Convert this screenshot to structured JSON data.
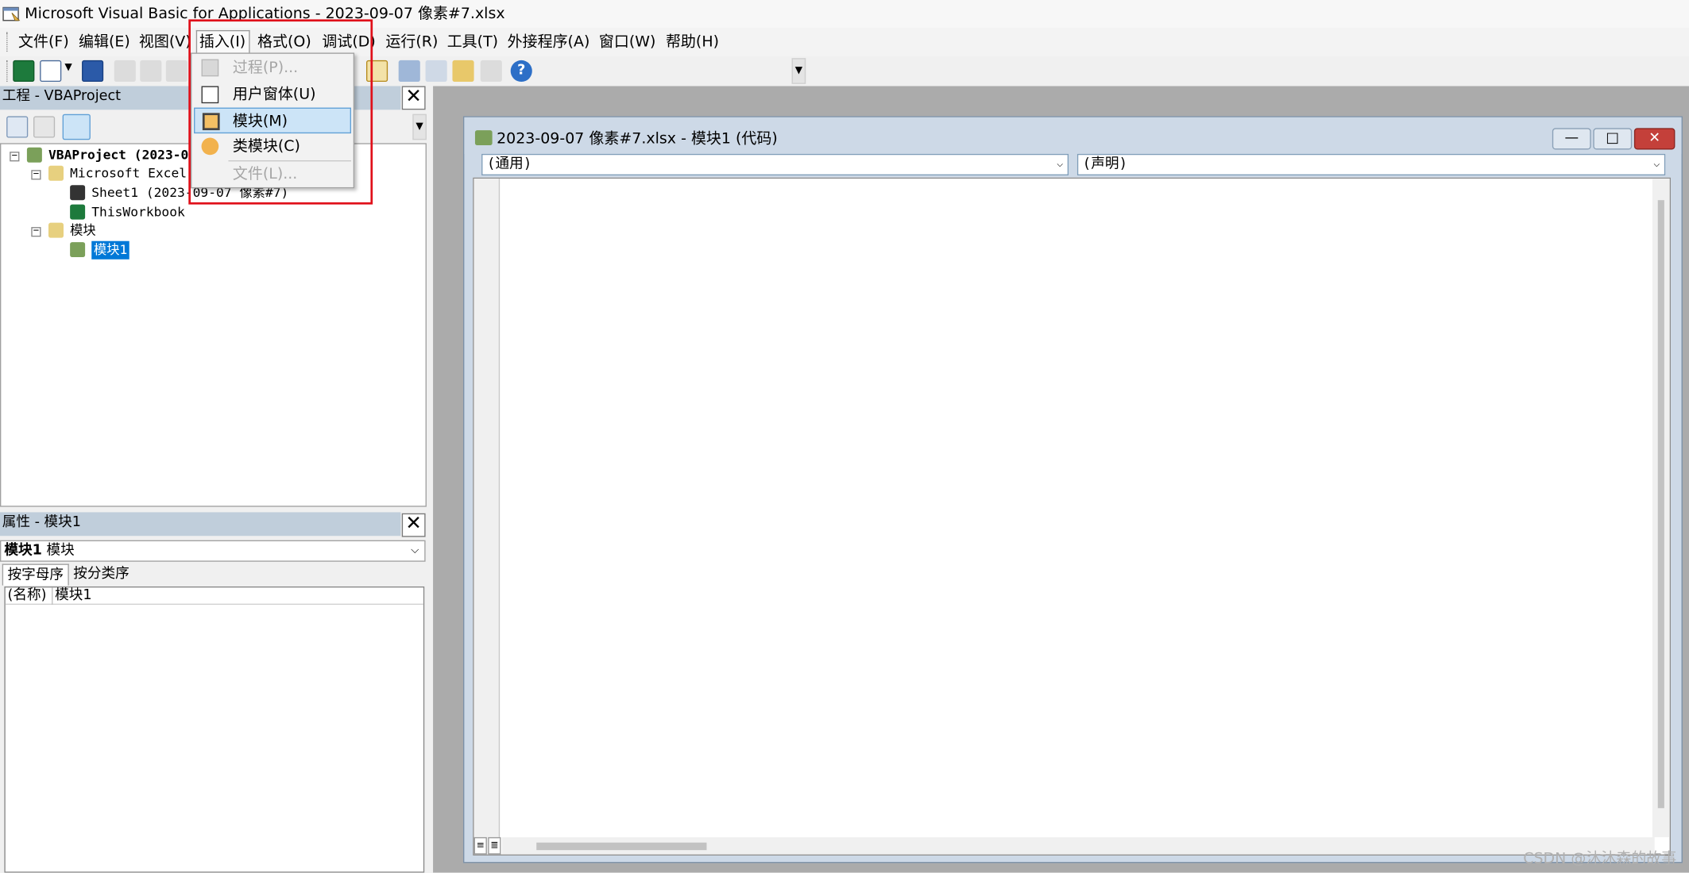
{
  "window": {
    "title": "Microsoft Visual Basic for Applications - 2023-09-07 像素#7.xlsx"
  },
  "menubar": {
    "items": [
      "文件(F)",
      "编辑(E)",
      "视图(V)",
      "插入(I)",
      "格式(O)",
      "调试(D)",
      "运行(R)",
      "工具(T)",
      "外接程序(A)",
      "窗口(W)",
      "帮助(H)"
    ],
    "active": "插入(I)"
  },
  "insert_menu": {
    "items": [
      {
        "label": "过程(P)...",
        "enabled": false,
        "icon": "procedure-icon"
      },
      {
        "label": "用户窗体(U)",
        "enabled": true,
        "icon": "userform-icon"
      },
      {
        "label": "模块(M)",
        "enabled": true,
        "highlighted": true,
        "icon": "module-icon"
      },
      {
        "label": "类模块(C)",
        "enabled": true,
        "icon": "class-module-icon"
      },
      {
        "label": "文件(L)...",
        "enabled": false,
        "icon": ""
      }
    ]
  },
  "project_panel": {
    "title": "工程 - VBAProject",
    "tree": [
      {
        "label": "VBAProject (2023-09",
        "bold": true
      },
      {
        "label": "Microsoft Excel 对"
      },
      {
        "label": "Sheet1 (2023-09-07 像素#7)"
      },
      {
        "label": "ThisWorkbook"
      },
      {
        "label": "模块"
      },
      {
        "label": "模块1",
        "selected": true
      }
    ]
  },
  "properties_panel": {
    "title": "属性 - 模块1",
    "object_name": "模块1",
    "object_type": "模块",
    "tabs": [
      "按字母序",
      "按分类序"
    ],
    "rows": [
      {
        "name": "(名称)",
        "value": "模块1"
      }
    ]
  },
  "code_window": {
    "title": "2023-09-07 像素#7.xlsx - 模块1 (代码)",
    "object_dropdown": "(通用)",
    "procedure_dropdown": "(声明)"
  },
  "watermark": "CSDN @沐沐森的故事",
  "colors": {
    "highlight": "#cce4f7",
    "panel_title": "#c0cedb",
    "tree_selected": "#0078d7",
    "red_annotation": "#e0101a"
  }
}
